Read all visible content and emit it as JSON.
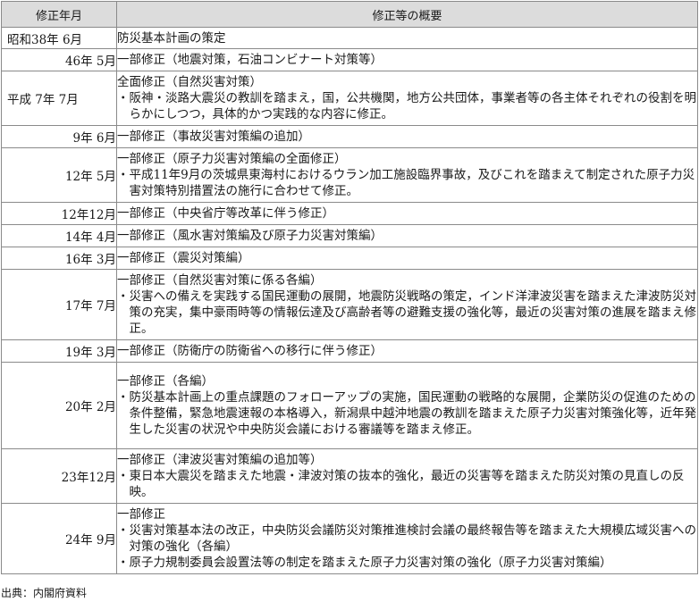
{
  "header": {
    "date_col": "修正年月",
    "summary_col": "修正等の概要"
  },
  "rows": [
    {
      "date": "昭和38年 6月",
      "heading": "防災基本計画の策定",
      "bullets": []
    },
    {
      "date": "46年 5月",
      "heading": "一部修正（地震対策，石油コンビナート対策等）",
      "bullets": []
    },
    {
      "date": "平成 7年 7月",
      "heading": "全面修正（自然災害対策）",
      "bullets": [
        "・阪神・淡路大震災の教訓を踏まえ，国，公共機関，地方公共団体，事業者等の各主体それぞれの役割を明らかにしつつ，具体的かつ実践的な内容に修正。"
      ]
    },
    {
      "date": "9年 6月",
      "heading": "一部修正（事故災害対策編の追加）",
      "bullets": []
    },
    {
      "date": "12年 5月",
      "heading": "一部修正（原子力災害対策編の全面修正）",
      "bullets": [
        "・平成11年9月の茨城県東海村におけるウラン加工施設臨界事故，及びこれを踏まえて制定された原子力災害対策特別措置法の施行に合わせて修正。"
      ]
    },
    {
      "date": "12年12月",
      "heading": "一部修正（中央省庁等改革に伴う修正）",
      "bullets": []
    },
    {
      "date": "14年 4月",
      "heading": "一部修正（風水害対策編及び原子力災害対策編）",
      "bullets": []
    },
    {
      "date": "16年 3月",
      "heading": "一部修正（震災対策編）",
      "bullets": []
    },
    {
      "date": "17年 7月",
      "heading": "一部修正（自然災害対策に係る各編）",
      "bullets": [
        "・災害への備えを実践する国民運動の展開，地震防災戦略の策定，インド洋津波災害を踏まえた津波防災対策の充実，集中豪雨時等の情報伝達及び高齢者等の避難支援の強化等，最近の災害対策の進展を踏まえ修正。"
      ]
    },
    {
      "date": "19年 3月",
      "heading": "一部修正（防衛庁の防衛省への移行に伴う修正）",
      "bullets": []
    },
    {
      "date": "20年 2月",
      "heading": "一部修正（各編）",
      "bullets": [
        "・防災基本計画上の重点課題のフォローアップの実施，国民運動の戦略的な展開，企業防災の促進のための条件整備，緊急地震速報の本格導入，新潟県中越沖地震の教訓を踏まえた原子力災害対策強化等，近年発生した災害の状況や中央防災会議における審議等を踏まえ修正。"
      ]
    },
    {
      "date": "23年12月",
      "heading": "一部修正（津波災害対策編の追加等）",
      "bullets": [
        "・東日本大震災を踏まえた地震・津波対策の抜本的強化，最近の災害等を踏まえた防災対策の見直しの反映。"
      ]
    },
    {
      "date": "24年 9月",
      "heading": "一部修正",
      "bullets": [
        "・災害対策基本法の改正，中央防災会議防災対策推進検討会議の最終報告等を踏まえた大規模広域災害への対策の強化（各編）",
        "・原子力規制委員会設置法等の制定を踏まえた原子力災害対策の強化（原子力災害対策編）"
      ]
    }
  ],
  "source": "出典：内閣府資料"
}
